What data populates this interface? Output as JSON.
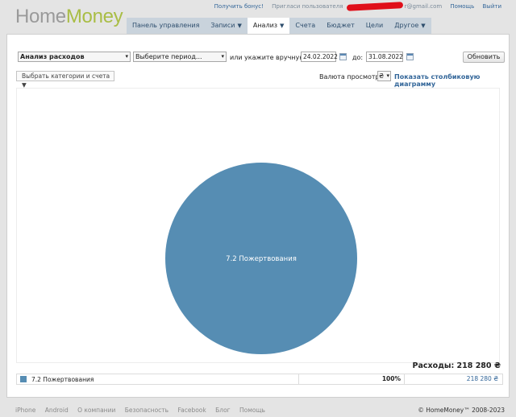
{
  "brand": {
    "home": "Home",
    "money": "Money"
  },
  "toplinks": {
    "bonus": "Получить бонус!",
    "invite": "Пригласи пользователя",
    "email_suffix": "r@gmail.com",
    "help": "Помощь",
    "logout": "Выйти"
  },
  "nav": {
    "tabs": [
      {
        "label": "Панель управления"
      },
      {
        "label": "Записи",
        "arrow": "▼"
      },
      {
        "label": "Анализ",
        "arrow": "▼"
      },
      {
        "label": "Счета"
      },
      {
        "label": "Бюджет"
      },
      {
        "label": "Цели"
      },
      {
        "label": "Другое",
        "arrow": "▼"
      }
    ]
  },
  "controls": {
    "report_type": "Анализ расходов",
    "period": "Выберите период...",
    "manual_text": "или укажите вручную с:",
    "date_from": "24.02.2022",
    "to_text": "до:",
    "date_to": "31.08.2022",
    "refresh": "Обновить",
    "categories": "Выбрать категории и счета ▼",
    "currency_label": "Валюта просмотра:",
    "currency_value": "₴",
    "dropdown_arrow": "▾",
    "bar_chart_link": "Показать столбиковую диаграмму"
  },
  "chart_data": {
    "type": "pie",
    "slices": [
      {
        "label": "7.2 Пожертвования",
        "value": 218280,
        "percent": 100,
        "color": "#568db3"
      }
    ]
  },
  "summary": {
    "total": "Расходы: 218 280 ₴"
  },
  "legend": [
    {
      "label": "7.2 Пожертвования",
      "percent": "100%",
      "amount": "218 280 ₴",
      "color": "#568db3"
    }
  ],
  "footer": {
    "links": [
      "iPhone",
      "Android",
      "О компании",
      "Безопасность",
      "Facebook",
      "Блог",
      "Помощь"
    ],
    "copyright": "© HomeMoney™ 2008-2023"
  }
}
